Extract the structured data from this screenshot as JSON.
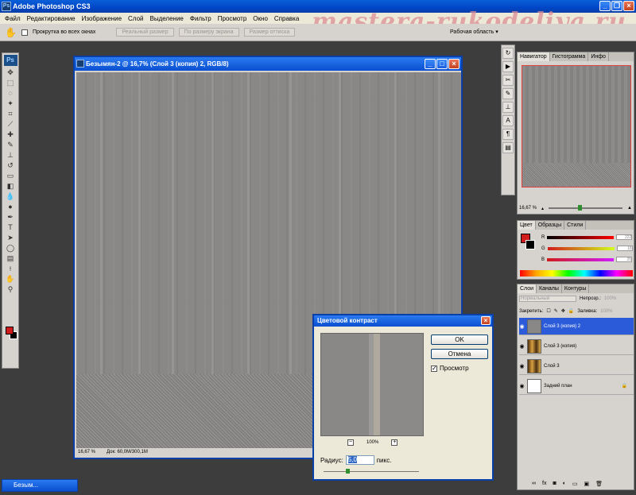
{
  "app": {
    "title": "Adobe Photoshop CS3",
    "logo": "Ps"
  },
  "watermark": "mastera-rukodeliya.ru",
  "menu": [
    "Файл",
    "Редактирование",
    "Изображение",
    "Слой",
    "Выделение",
    "Фильтр",
    "Просмотр",
    "Окно",
    "Справка"
  ],
  "options": {
    "checkbox_label": "Прокрутка во всех окнах",
    "actual_pixels": "Реальный размер",
    "fit_screen": "По размеру экрана",
    "print_size": "Размер оттиска",
    "workspace": "Рабочая область"
  },
  "document": {
    "title": "Безымян-2 @ 16,7% (Слой 3 (копия) 2, RGB/8)",
    "zoom": "16,67 %",
    "doc_info": "Док: 60,0M/300,1M"
  },
  "navigator": {
    "tabs": [
      "Навигатор",
      "Гистограмма",
      "Инфо"
    ],
    "zoom": "16,67 %"
  },
  "color_panel": {
    "tabs": [
      "Цвет",
      "Образцы",
      "Стили"
    ],
    "channels": [
      {
        "label": "R",
        "value": "222"
      },
      {
        "label": "G",
        "value": "18"
      },
      {
        "label": "B",
        "value": "25"
      }
    ]
  },
  "layers": {
    "tabs": [
      "Слои",
      "Каналы",
      "Контуры"
    ],
    "blend_mode": "Нормальный",
    "opacity_label": "Непрозр.:",
    "opacity": "100%",
    "lock_label": "Закрепить:",
    "fill_label": "Заливка:",
    "fill": "100%",
    "items": [
      {
        "name": "Слой 3 (копия) 2",
        "active": true
      },
      {
        "name": "Слой 3 (копия)",
        "active": false
      },
      {
        "name": "Слой 3",
        "active": false
      },
      {
        "name": "Задний план",
        "active": false
      }
    ]
  },
  "dialog": {
    "title": "Цветовой контраст",
    "ok": "OK",
    "cancel": "Отмена",
    "preview_label": "Просмотр",
    "zoom": "100%",
    "radius_label": "Радиус:",
    "radius_value": "5,0",
    "units": "пикс."
  },
  "taskbar": {
    "item": "Безым..."
  }
}
